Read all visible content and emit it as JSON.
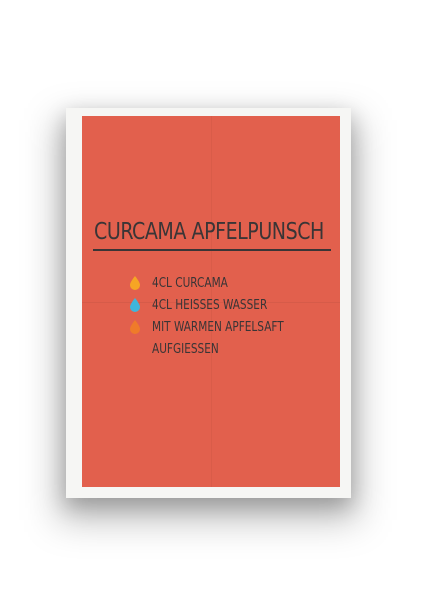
{
  "poster": {
    "title": "CURCAMA APFELPUNSCH",
    "ingredients": [
      {
        "text": "4cl Curcama",
        "drop_color": "#f6a524",
        "icon": "drop-icon"
      },
      {
        "text": "4cl heisses Wasser",
        "drop_color": "#3fb6dc",
        "icon": "drop-icon"
      },
      {
        "text": "mit warmen Apfelsaft",
        "drop_color": "#ef7b2a",
        "icon": "drop-icon"
      }
    ],
    "ingredient_continuation": "aufgiessen",
    "background_color": "#e2604d",
    "text_color": "#3a3536"
  }
}
